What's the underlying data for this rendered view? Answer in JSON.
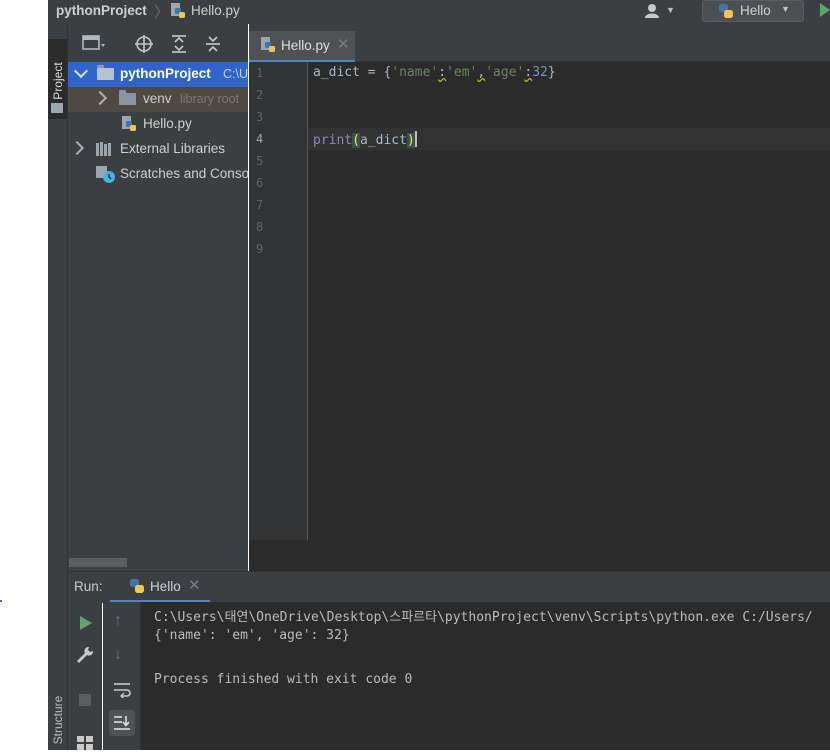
{
  "navbar": {
    "project": "pythonProject",
    "file": "Hello.py",
    "run_config": "Hello"
  },
  "stripe": {
    "project_label": "Project",
    "structure_label": "Structure"
  },
  "project_tree": {
    "root_label": "pythonProject",
    "root_path": "C:\\U",
    "venv_label": "venv",
    "venv_hint": "library root",
    "file_label": "Hello.py",
    "external_libraries": "External Libraries",
    "scratches": "Scratches and Consoles"
  },
  "editor": {
    "tab_label": "Hello.py",
    "line_numbers": [
      "1",
      "2",
      "3",
      "4",
      "5",
      "6",
      "7",
      "8",
      "9"
    ],
    "code": {
      "l1_var": "a_dict = {",
      "l1_key1": "'name'",
      "l1_colon1": ":",
      "l1_val1": "'em'",
      "l1_comma": ",",
      "l1_key2": "'age'",
      "l1_colon2": ":",
      "l1_val2": "32",
      "l1_close": "}",
      "l4_fn": "print",
      "l4_open": "(",
      "l4_arg": "a_dict",
      "l4_close": ")"
    }
  },
  "run_panel": {
    "title": "Run:",
    "tab_label": "Hello",
    "console_lines": [
      "C:\\Users\\태연\\OneDrive\\Desktop\\스파르타\\pythonProject\\venv\\Scripts\\python.exe C:/Users/",
      "{'name': 'em', 'age': 32}",
      "",
      "Process finished with exit code 0"
    ]
  },
  "colors": {
    "bg_dark": "#2b2b2b",
    "panel": "#3c3f41",
    "accent_blue": "#4a88c7",
    "run_green": "#59a869",
    "string_green": "#6a8759",
    "number_blue": "#6897bb"
  }
}
